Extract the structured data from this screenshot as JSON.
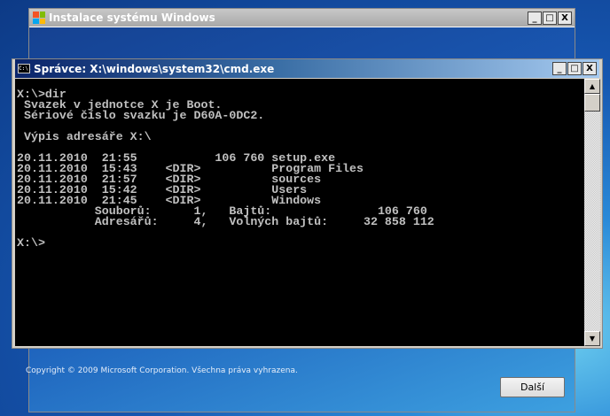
{
  "setup_window": {
    "title": "Instalace systému Windows",
    "copyright": "Copyright © 2009 Microsoft Corporation. Všechna práva vyhrazena.",
    "next_button": "Další",
    "controls": {
      "minimize": "_",
      "maximize": "□",
      "close": "X"
    }
  },
  "cmd_window": {
    "title": "Správce: X:\\windows\\system32\\cmd.exe",
    "icon_text": "C:\\.",
    "lines": [
      "X:\\>dir",
      " Svazek v jednotce X je Boot.",
      " Sériové číslo svazku je D60A-0DC2.",
      "",
      " Výpis adresáře X:\\",
      "",
      "20.11.2010  21:55           106 760 setup.exe",
      "20.11.2010  15:43    <DIR>          Program Files",
      "20.11.2010  21:57    <DIR>          sources",
      "20.11.2010  15:42    <DIR>          Users",
      "20.11.2010  21:45    <DIR>          Windows",
      "           Souborů:      1,   Bajtů:               106 760",
      "           Adresářů:     4,   Volných bajtů:     32 858 112",
      "",
      "X:\\>"
    ]
  }
}
